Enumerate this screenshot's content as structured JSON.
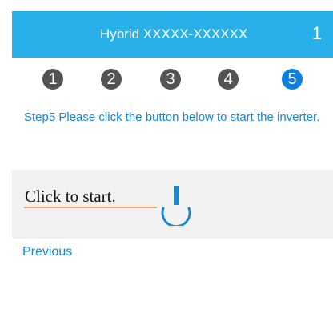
{
  "header": {
    "title": "Hybrid XXXXX-XXXXXX",
    "page_indicator": "1"
  },
  "steps": [
    {
      "label": "1",
      "active": false
    },
    {
      "label": "2",
      "active": false
    },
    {
      "label": "3",
      "active": false
    },
    {
      "label": "4",
      "active": false
    },
    {
      "label": "5",
      "active": true
    }
  ],
  "instruction": {
    "text": "Step5 Please click the button below to start the inverter."
  },
  "start_panel": {
    "text": "Click to start.",
    "icon": "power-icon"
  },
  "navigation": {
    "previous_label": "Previous"
  },
  "colors": {
    "header_bg": "#28b0ea",
    "active_step": "#0b80de",
    "inactive_step": "#535353",
    "link_text": "#1788d6",
    "panel_bg": "#f2f2f2",
    "accent_underline": "#f0a66f"
  }
}
